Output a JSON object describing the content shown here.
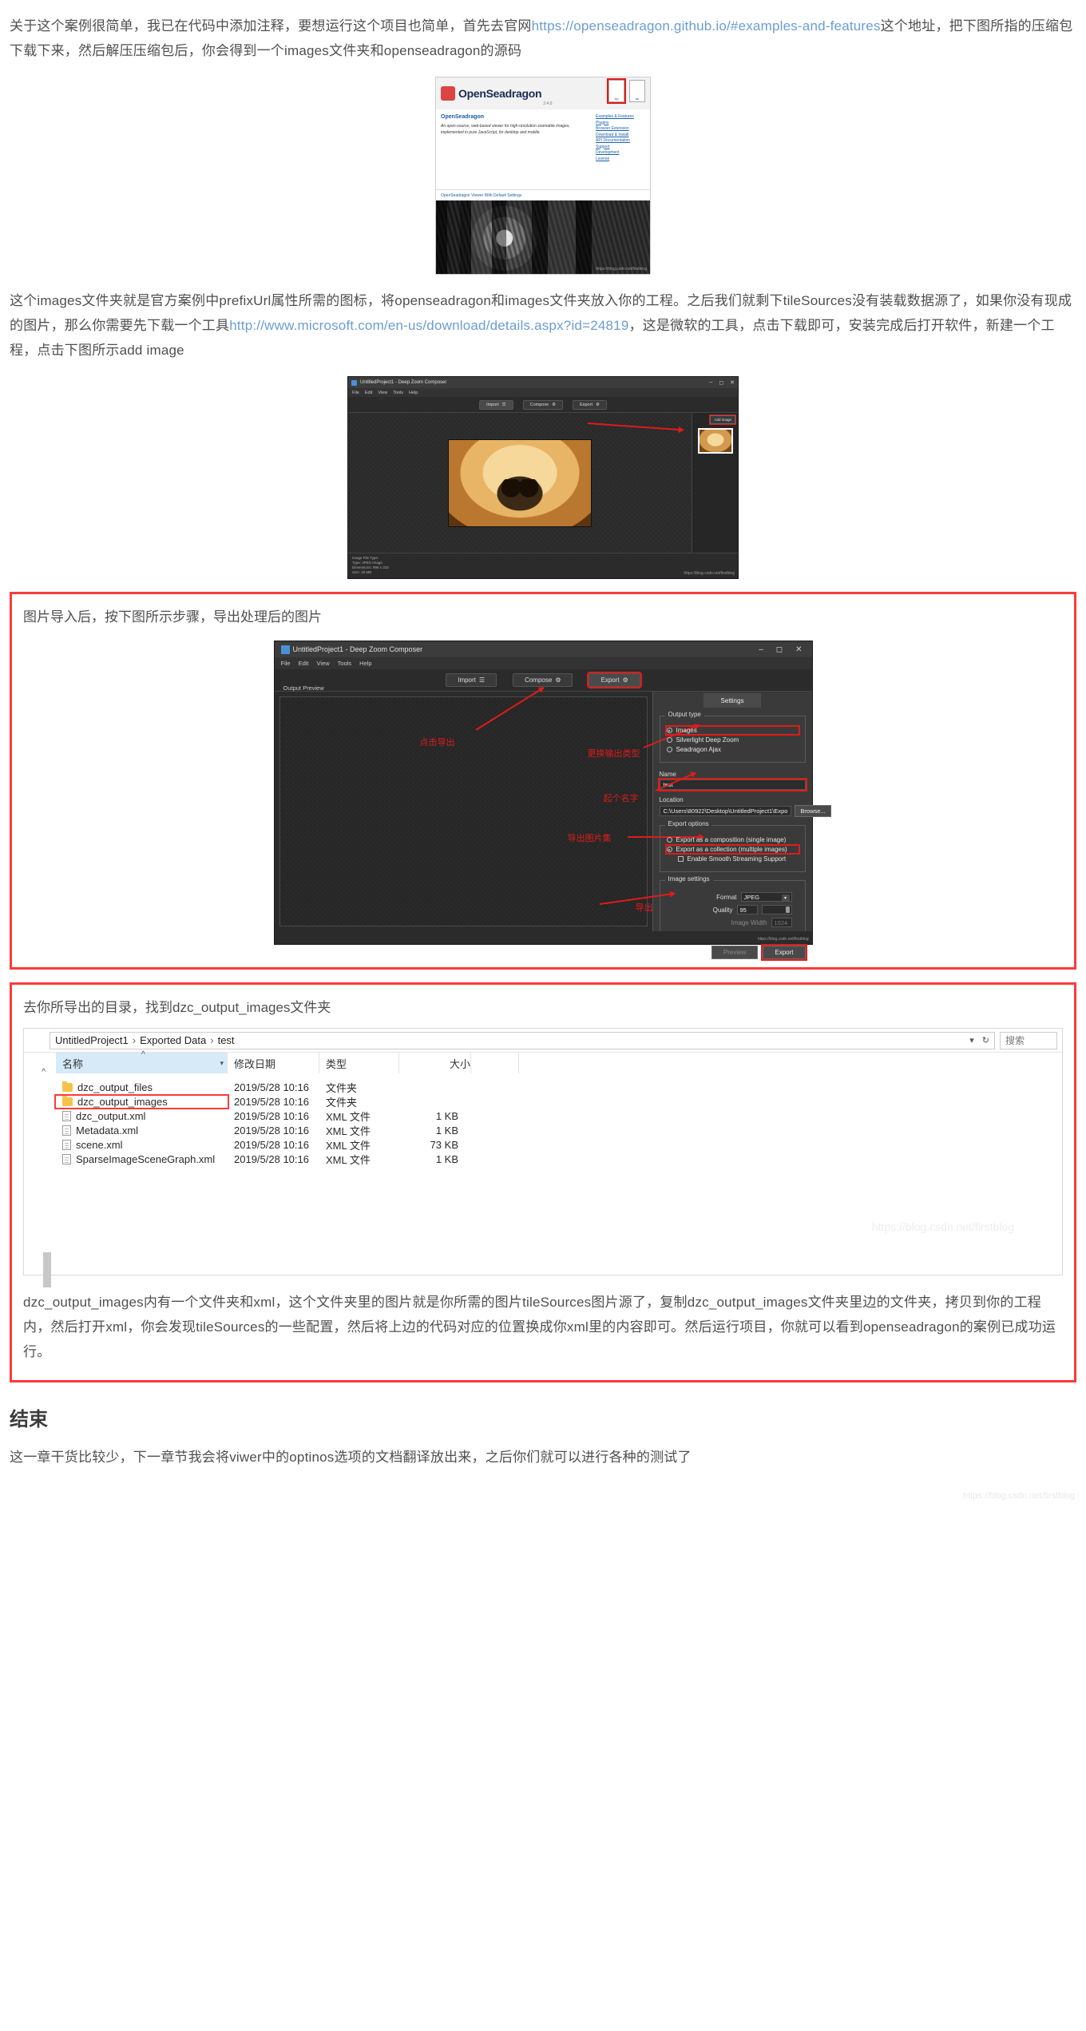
{
  "article": {
    "p1_part1": "关于这个案例很简单，我已在代码中添加注释，要想运行这个项目也简单，首先去官网",
    "p1_link": "https://openseadragon.github.io/#examples-and-features",
    "p1_part2": "这个地址，把下图所指的压缩包下载下来，然后解压压缩包后，你会得到一个images文件夹和openseadragon的源码",
    "p2_part1": "这个images文件夹就是官方案例中prefixUrl属性所需的图标，将openseadragon和images文件夹放入你的工程。之后我们就剩下tileSources没有装载数据源了，如果你没有现成的图片，那么你需要先下载一个工具",
    "p2_link": "http://www.microsoft.com/en-us/download/details.aspx?id=24819",
    "p2_part2": "，这是微软的工具，点击下载即可，安装完成后打开软件，新建一个工程，点击下图所示add image",
    "p_final": "dzc_output_images内有一个文件夹和xml，这个文件夹里的图片就是你所需的图片tileSources图片源了，复制dzc_output_images文件夹里边的文件夹，拷贝到你的工程内，然后打开xml，你会发现tileSources的一些配置，然后将上边的代码对应的位置换成你xml里的内容即可。然后运行项目，你就可以看到openseadragon的案例已成功运行。",
    "section_title": "结束",
    "p_end": "这一章干货比较少，下一章节我会将viwer中的optinos选项的文档翻译放出来，之后你们就可以进行各种的测试了",
    "watermark": "https://blog.csdn.net/firstblog"
  },
  "shot_openseadragon": {
    "logo_text": "OpenSeadragon",
    "logo_version": "2.4.0",
    "download_labels": [
      "zip",
      "tar"
    ],
    "heading": "OpenSeadragon",
    "intro": "An open-source, web-based viewer for high-resolution zoomable images, implemented in pure JavaScript, for desktop and mobile.",
    "nav_links": [
      "Examples & Features",
      "Plugins",
      "Browser Extension",
      "Download & Install",
      "API Documentation",
      "Support",
      "Development",
      "License"
    ],
    "caption": "OpenSeadragon Viewer With Default Settings",
    "watermark": "https://blog.csdn.net/firstblog"
  },
  "shot_import": {
    "title": "UntitledProject1 - Deep Zoom Composer",
    "menus": [
      "File",
      "Edit",
      "View",
      "Tools",
      "Help"
    ],
    "tabs": [
      "Import",
      "Compose",
      "Export"
    ],
    "add_image_label": "Add image",
    "file_info_title": "Image File Type:",
    "file_info_lines": [
      "Type: JPEG Image",
      "Dimensions: 998 x 333",
      "Size: 29 MB"
    ],
    "watermark": "https://blog.csdn.net/firstblog"
  },
  "redbox_export": {
    "caption": "图片导入后，按下图所示步骤，导出处理后的图片"
  },
  "shot_export": {
    "title": "UntitledProject1 - Deep Zoom Composer",
    "menus": [
      "File",
      "Edit",
      "View",
      "Tools",
      "Help"
    ],
    "tabs": [
      "Import",
      "Compose",
      "Export"
    ],
    "output_preview_label": "Output Preview",
    "settings_tab": "Settings",
    "output_type_label": "Output type",
    "output_type_options": [
      "Images",
      "Silverlight Deep Zoom",
      "Seadragon Ajax"
    ],
    "output_type_selected": "Images",
    "name_label": "Name",
    "name_value": "test",
    "location_label": "Location",
    "location_value": "C:\\Users\\80922\\Desktop\\UntitledProject1\\Expo",
    "browse_label": "Browse...",
    "export_options_label": "Export options",
    "export_options": [
      "Export as a composition (single image)",
      "Export as a collection (multiple images)"
    ],
    "export_option_selected": "Export as a collection (multiple images)",
    "smooth_streaming_label": "Enable Smooth Streaming Support",
    "image_settings_label": "Image settings",
    "format_label": "Format",
    "format_value": "JPEG",
    "quality_label": "Quality",
    "quality_value": "95",
    "image_width_label": "Image Width",
    "image_width_value": "1024",
    "preview_btn": "Preview",
    "export_btn": "Export",
    "annotations": [
      "点击导出",
      "更换输出类型",
      "起个名字",
      "导出图片集",
      "导出"
    ],
    "watermark": "https://blog.csdn.net/firstblog"
  },
  "redbox_explorer": {
    "caption": "去你所导出的目录，找到dzc_output_images文件夹"
  },
  "explorer": {
    "breadcrumbs": [
      "UntitledProject1",
      "Exported Data",
      "test"
    ],
    "refresh_icon": "refresh-icon",
    "search_placeholder": "搜索",
    "columns": [
      "名称",
      "修改日期",
      "类型",
      "大小"
    ],
    "rows": [
      {
        "name": "dzc_output_files",
        "date": "2019/5/28 10:16",
        "type": "文件夹",
        "size": "",
        "icon": "folder",
        "highlighted": false
      },
      {
        "name": "dzc_output_images",
        "date": "2019/5/28 10:16",
        "type": "文件夹",
        "size": "",
        "icon": "folder",
        "highlighted": true
      },
      {
        "name": "dzc_output.xml",
        "date": "2019/5/28 10:16",
        "type": "XML 文件",
        "size": "1 KB",
        "icon": "xml",
        "highlighted": false
      },
      {
        "name": "Metadata.xml",
        "date": "2019/5/28 10:16",
        "type": "XML 文件",
        "size": "1 KB",
        "icon": "xml",
        "highlighted": false
      },
      {
        "name": "scene.xml",
        "date": "2019/5/28 10:16",
        "type": "XML 文件",
        "size": "73 KB",
        "icon": "xml",
        "highlighted": false
      },
      {
        "name": "SparseImageSceneGraph.xml",
        "date": "2019/5/28 10:16",
        "type": "XML 文件",
        "size": "1 KB",
        "icon": "xml",
        "highlighted": false
      }
    ],
    "watermark": "https://blog.csdn.net/firstblog"
  },
  "colors": {
    "link": "#6b9dd4",
    "annotation_red": "#e01b1b",
    "box_red": "#fb3b3b",
    "text": "#4f4f4f"
  }
}
